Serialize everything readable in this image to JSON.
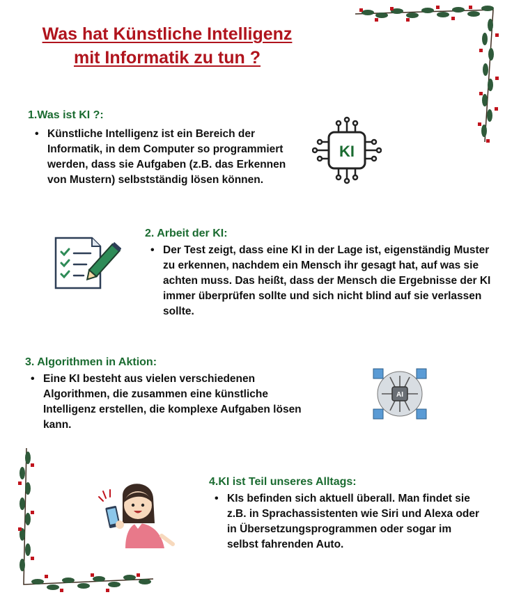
{
  "title": {
    "line1": "Was hat Künstliche Intelligenz",
    "line2": "mit Informatik zu tun ?"
  },
  "sections": [
    {
      "heading": "1.Was ist KI ?:",
      "text": "Künstliche Intelligenz ist ein Bereich der Informatik, in dem Computer so programmiert werden, dass sie Aufgaben (z.B. das Erkennen von Mustern) selbstständig lösen können."
    },
    {
      "heading": "2. Arbeit der KI:",
      "text": "Der Test zeigt, dass eine KI in der Lage ist, eigenständig Muster zu erkennen, nachdem ein Mensch ihr gesagt hat, auf was sie achten muss. Das heißt, dass der Mensch die Ergebnisse der KI immer überprüfen sollte und sich nicht blind auf sie verlassen sollte."
    },
    {
      "heading": "3. Algorithmen in Aktion:",
      "text": "Eine KI besteht aus vielen verschiedenen Algorithmen, die zusammen eine künstliche Intelligenz erstellen, die komplexe Aufgaben lösen kann."
    },
    {
      "heading": "4.KI ist Teil unseres Alltags:",
      "text": "KIs befinden sich aktuell überall. Man findet sie z.B. in Sprachassistenten wie Siri und Alexa oder in Übersetzungsprogrammen oder sogar im selbst fahrenden Auto."
    }
  ],
  "icons": {
    "chip_label": "KI",
    "ai_label": "AI",
    "chip": "ki-chip-icon",
    "checklist": "checklist-pencil-icon",
    "network": "ai-network-icon",
    "person": "person-with-phone-illustration",
    "garland": "holly-garland-decoration"
  },
  "colors": {
    "title": "#b0141d",
    "heading": "#1a6b30",
    "text": "#111111",
    "holly_green": "#2f5a3a",
    "berry_red": "#c0141d"
  }
}
